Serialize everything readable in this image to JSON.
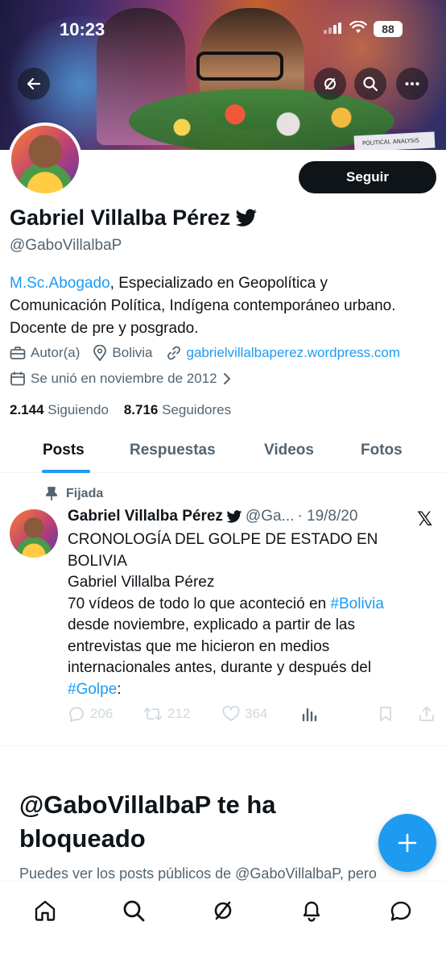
{
  "status_bar": {
    "time": "10:23",
    "battery": "88"
  },
  "banner": {
    "caption": "POLITICAL ANALYSIS"
  },
  "profile": {
    "follow_label": "Seguir",
    "name": "Gabriel Villalba Pérez",
    "handle": "@GaboVillalbaP",
    "bio": {
      "link_text": "M.Sc.Abogado",
      "line1_rest": ", Especializado en Geopolítica y",
      "line2": "Comunicación Política, Indígena contemporáneo urbano.",
      "line3": "Docente de pre y posgrado."
    },
    "category": "Autor(a)",
    "location": "Bolivia",
    "website": "gabrielvillalbaperez.wordpress.com",
    "joined": "Se unió en noviembre de 2012",
    "following_count": "2.144",
    "following_label": "Siguiendo",
    "followers_count": "8.716",
    "followers_label": "Seguidores"
  },
  "tabs": [
    {
      "label": "Posts"
    },
    {
      "label": "Respuestas"
    },
    {
      "label": "Videos"
    },
    {
      "label": "Fotos"
    }
  ],
  "pinned_tweet": {
    "pinned_label": "Fijada",
    "author": "Gabriel Villalba Pérez",
    "handle_short": "@Ga...",
    "date": "· 19/8/20",
    "title_line1": "CRONOLOGÍA DEL GOLPE DE ESTADO EN",
    "title_line2": "BOLIVIA",
    "author_line": "Gabriel Villalba Pérez",
    "body_part1": "70 vídeos de todo lo que aconteció en ",
    "hashtag1": "#Bolivia",
    "body_line2": "desde noviembre, explicado a partir de las",
    "body_line3": "entrevistas que me hicieron en medios",
    "body_line4": "internacionales antes, durante y después del",
    "hashtag2": "#Golpe",
    "body_end": ":",
    "replies": "206",
    "retweets": "212",
    "likes": "364"
  },
  "blocked": {
    "title": "@GaboVillalbaP te ha bloqueado",
    "text": "Puedes ver los posts públicos de @GaboVillalbaP, pero"
  },
  "colors": {
    "accent": "#1d9bf0",
    "text": "#0f1419",
    "muted": "#536471"
  }
}
